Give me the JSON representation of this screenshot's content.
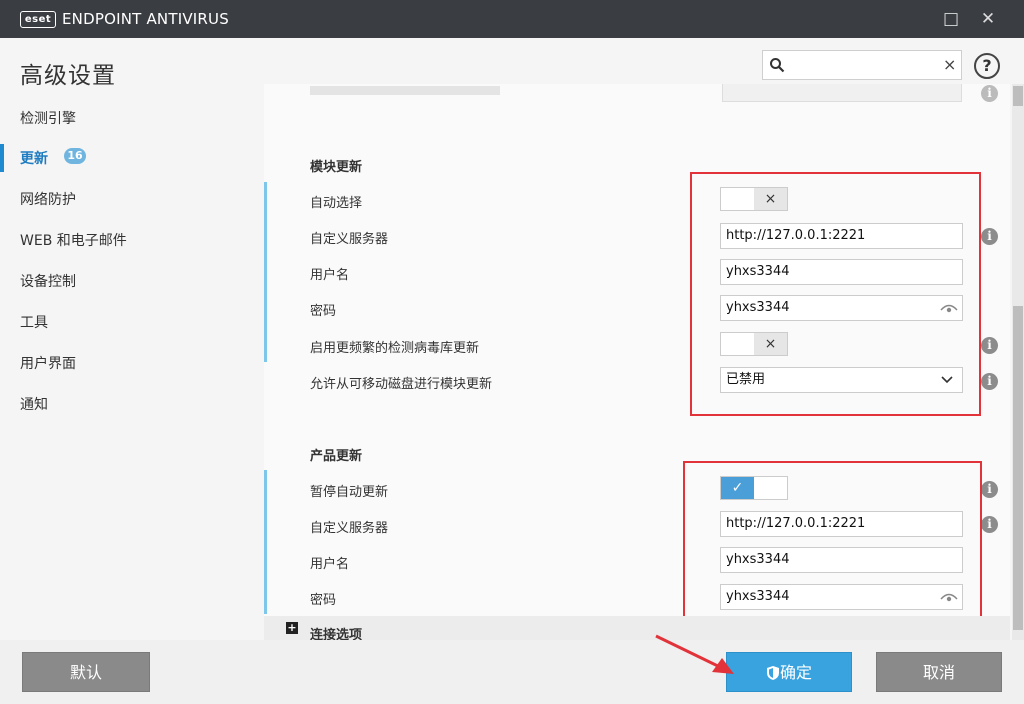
{
  "app": {
    "logo_text": "eset",
    "title": "ENDPOINT ANTIVIRUS"
  },
  "window": {
    "maximize": "□",
    "close": "✕"
  },
  "header": {
    "title": "高级设置",
    "search_value": "",
    "search_clear": "×",
    "help": "?"
  },
  "sidebar": {
    "items": [
      {
        "label": "检测引擎"
      },
      {
        "label": "更新",
        "badge": "16",
        "active": true
      },
      {
        "label": "网络防护"
      },
      {
        "label": "WEB 和电子邮件"
      },
      {
        "label": "设备控制"
      },
      {
        "label": "工具"
      },
      {
        "label": "用户界面"
      },
      {
        "label": "通知"
      }
    ]
  },
  "module_update": {
    "title": "模块更新",
    "auto_select": {
      "label": "自动选择",
      "state": "×"
    },
    "custom_server": {
      "label": "自定义服务器",
      "value": "http://127.0.0.1:2221"
    },
    "username": {
      "label": "用户名",
      "value": "yhxs3344"
    },
    "password": {
      "label": "密码",
      "value": "yhxs3344"
    },
    "frequent": {
      "label": "启用更频繁的检测病毒库更新",
      "state": "×"
    },
    "removable": {
      "label": "允许从可移动磁盘进行模块更新",
      "value": "已禁用"
    }
  },
  "product_update": {
    "title": "产品更新",
    "pause": {
      "label": "暂停自动更新",
      "state": "✓"
    },
    "custom_server": {
      "label": "自定义服务器",
      "value": "http://127.0.0.1:2221"
    },
    "username": {
      "label": "用户名",
      "value": "yhxs3344"
    },
    "password": {
      "label": "密码",
      "value": "yhxs3344"
    }
  },
  "connection": {
    "expand": "+",
    "label": "连接选项"
  },
  "info_glyph": "i",
  "footer": {
    "default": "默认",
    "ok": "确定",
    "cancel": "取消"
  },
  "colors": {
    "accent": "#39a3e0",
    "highlight": "#e2333a",
    "titlebar": "#3a3d42"
  }
}
